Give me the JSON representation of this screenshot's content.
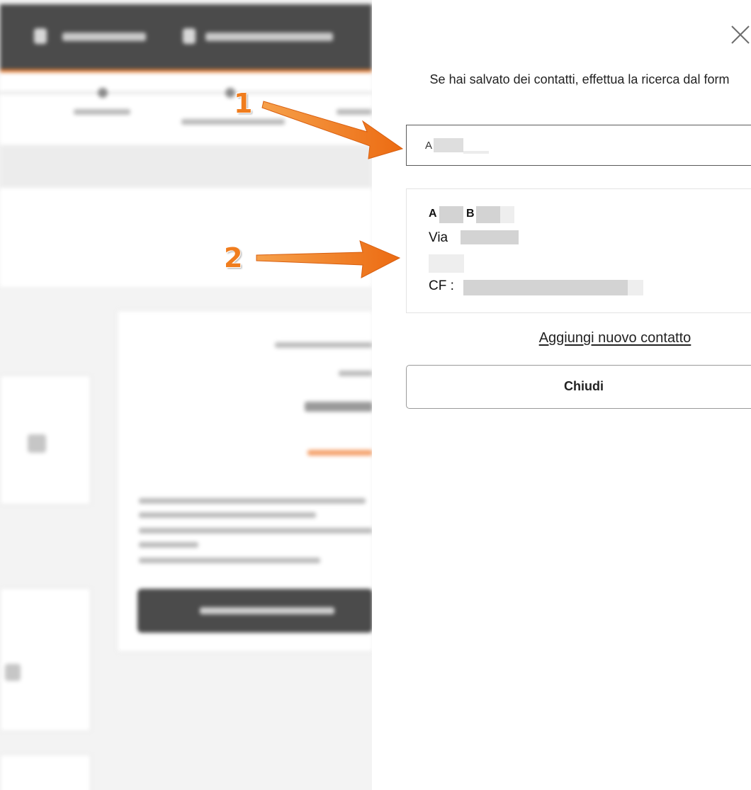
{
  "drawer": {
    "hint_text": "Se hai salvato dei contatti, effettua la ricerca dal form",
    "search": {
      "value": "A"
    },
    "contact": {
      "name_initial": "A",
      "surname_initial": "B",
      "address_prefix": "Via",
      "cf_label": "CF :"
    },
    "add_contact_label": "Aggiungi nuovo contatto",
    "close_label": "Chiudi"
  },
  "annotations": [
    {
      "label": "1"
    },
    {
      "label": "2"
    }
  ],
  "colors": {
    "accent": "#f07d1e",
    "header_bg": "#4b4b4b",
    "text": "#222222"
  },
  "icons": {
    "close": "close-x-icon"
  }
}
